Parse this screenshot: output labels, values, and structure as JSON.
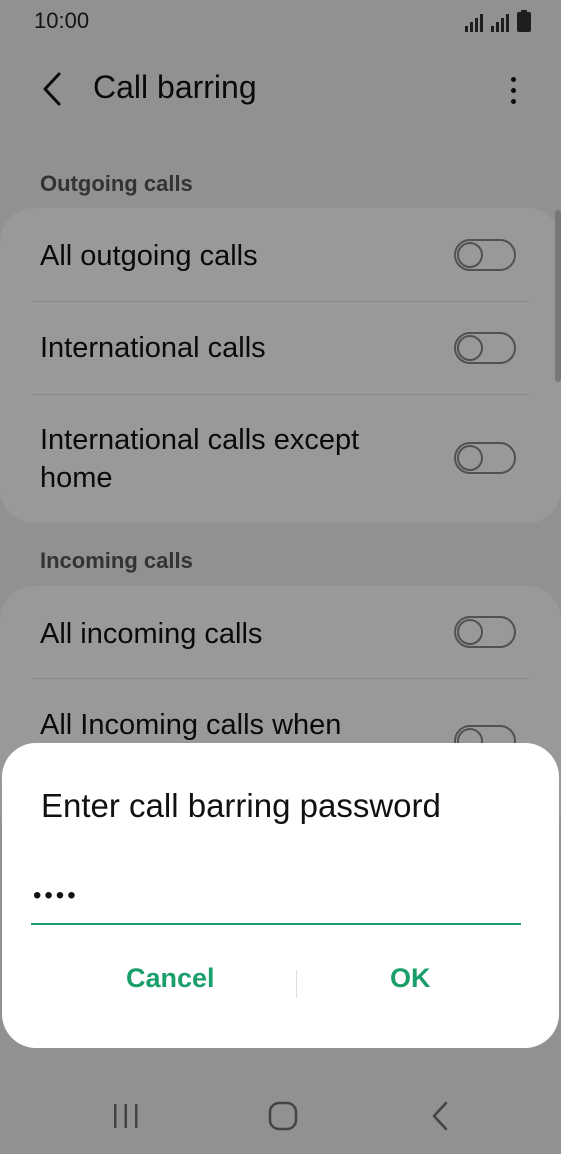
{
  "status_bar": {
    "time": "10:00",
    "icons": [
      "signal-icon",
      "signal-icon",
      "battery-icon"
    ]
  },
  "app_bar": {
    "title": "Call barring",
    "back_icon": "chevron-left-icon",
    "more_icon": "more-vertical-icon"
  },
  "sections": [
    {
      "header": "Outgoing calls",
      "items": [
        {
          "label": "All outgoing calls",
          "enabled": false
        },
        {
          "label": "International calls",
          "enabled": false
        },
        {
          "label": "International calls except home",
          "enabled": false
        }
      ]
    },
    {
      "header": "Incoming calls",
      "items": [
        {
          "label": "All incoming calls",
          "enabled": false
        },
        {
          "label": "All Incoming calls when",
          "enabled": false
        }
      ]
    }
  ],
  "dialog": {
    "title": "Enter call barring password",
    "password_value": "••••",
    "cancel_label": "Cancel",
    "ok_label": "OK"
  },
  "nav_bar": {
    "buttons": [
      "recents-icon",
      "home-icon",
      "back-icon"
    ]
  },
  "colors": {
    "accent": "#1a9e6a",
    "background": "#f2f2f2",
    "card": "#ffffff"
  }
}
